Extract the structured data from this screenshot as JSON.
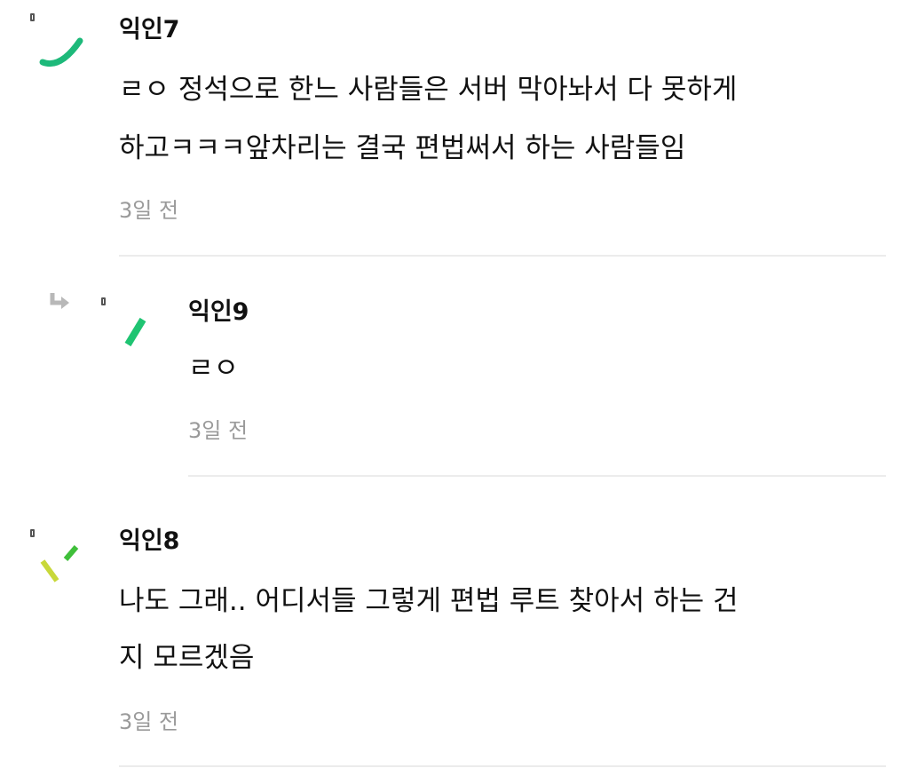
{
  "comments": [
    {
      "author": "익인7",
      "lines": [
        "ㄹㅇ 정석으로 한느 사람들은 서버 막아놔서 다 못하게",
        "하고ㅋㅋㅋ앞차리는 결국 편법써서 하는 사람들임"
      ],
      "time": "3일 전",
      "avatar_color": "#1db97a"
    },
    {
      "author": "익인9",
      "lines": [
        "ㄹㅇ"
      ],
      "time": "3일 전",
      "is_reply": true,
      "avatar_color": "#1fc472"
    },
    {
      "author": "익인8",
      "lines": [
        "나도 그래.. 어디서들 그렇게 편법 루트 찾아서 하는 건",
        "지 모르겠음"
      ],
      "time": "3일 전",
      "avatar_colors": [
        "#c8d83a",
        "#3fbf3a"
      ]
    }
  ],
  "icons": {
    "reply": "reply-arrow-icon",
    "badge": "tag-icon"
  }
}
